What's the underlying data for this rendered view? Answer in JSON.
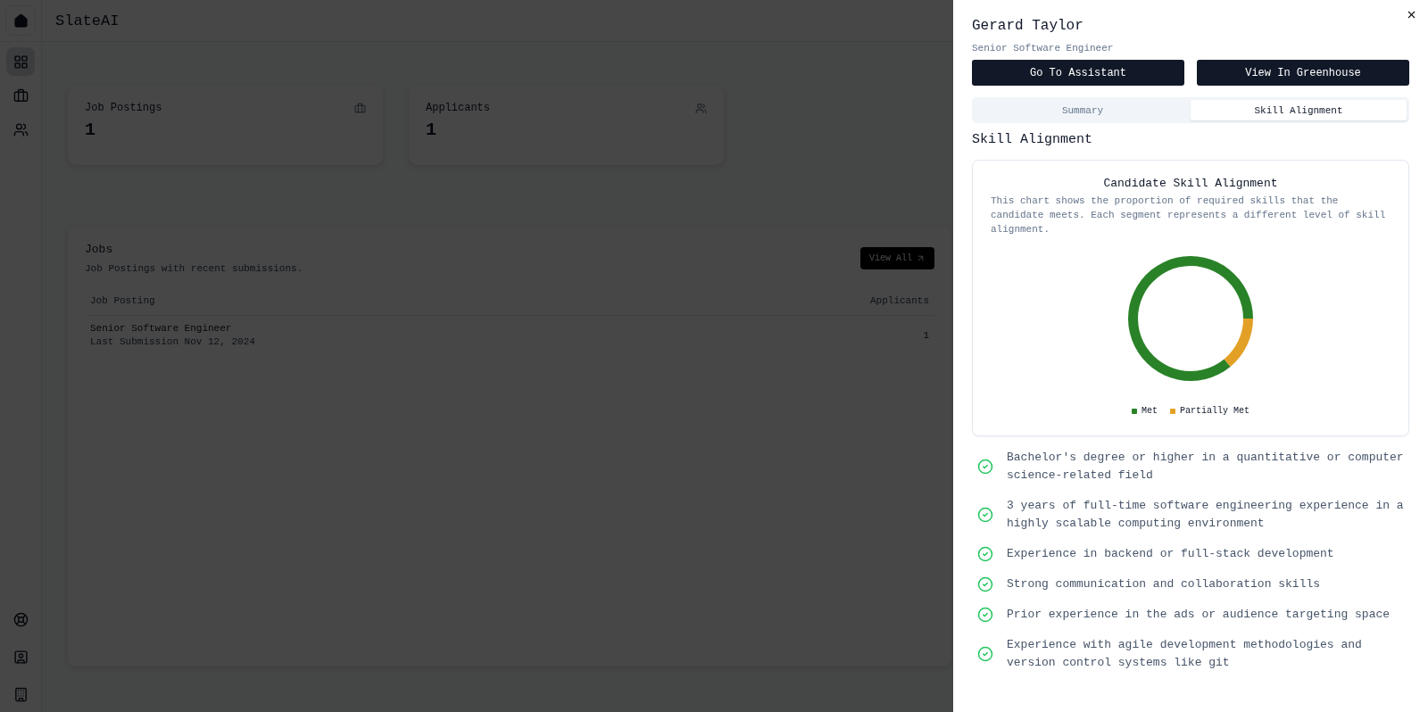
{
  "app": {
    "title": "SlateAI"
  },
  "sidebar": {
    "items": [
      {
        "kind": "dashboard",
        "selected": true
      },
      {
        "kind": "jobs",
        "selected": false
      },
      {
        "kind": "people",
        "selected": false
      }
    ],
    "bottom_items": [
      {
        "kind": "support"
      },
      {
        "kind": "account"
      },
      {
        "kind": "company"
      }
    ]
  },
  "stats": [
    {
      "label": "Job Postings",
      "value": "1",
      "kind": "jobs"
    },
    {
      "label": "Applicants",
      "value": "1",
      "kind": "people"
    }
  ],
  "jobs": {
    "title": "Jobs",
    "subtitle": "Job Postings with recent submissions.",
    "view_all": "View All",
    "columns": [
      "Job Posting",
      "Applicants"
    ],
    "rows": [
      {
        "title": "Senior Software Engineer",
        "meta": "Last Submission Nov 12, 2024",
        "applicants": "1"
      }
    ]
  },
  "drawer": {
    "name": "Gerard Taylor",
    "role": "Senior Software Engineer",
    "buttons": [
      "Go To Assistant",
      "View In Greenhouse"
    ],
    "tabs": [
      {
        "label": "Summary",
        "selected": false
      },
      {
        "label": "Skill Alignment",
        "selected": true
      }
    ],
    "section_title": "Skill Alignment",
    "chart_card": {
      "title": "Candidate Skill Alignment",
      "description": "This chart shows the proportion of required skills that the candidate meets. Each segment represents a different level of skill alignment.",
      "chart_data": {
        "type": "donut",
        "categories": [
          "Met",
          "Partially Met"
        ],
        "values": [
          86,
          14
        ],
        "colors": [
          "#2a8228",
          "#e2a126"
        ]
      }
    },
    "skills": [
      {
        "text": "Bachelor's degree or higher in a quantitative or computer science-related field",
        "met": true
      },
      {
        "text": "3 years of full-time software engineering experience in a highly scalable computing environment",
        "met": true
      },
      {
        "text": "Experience in backend or full-stack development",
        "met": true
      },
      {
        "text": "Strong communication and collaboration skills",
        "met": true
      },
      {
        "text": "Prior experience in the ads or audience targeting space",
        "met": true
      },
      {
        "text": "Experience with agile development methodologies and version control systems like git",
        "met": true
      }
    ]
  }
}
